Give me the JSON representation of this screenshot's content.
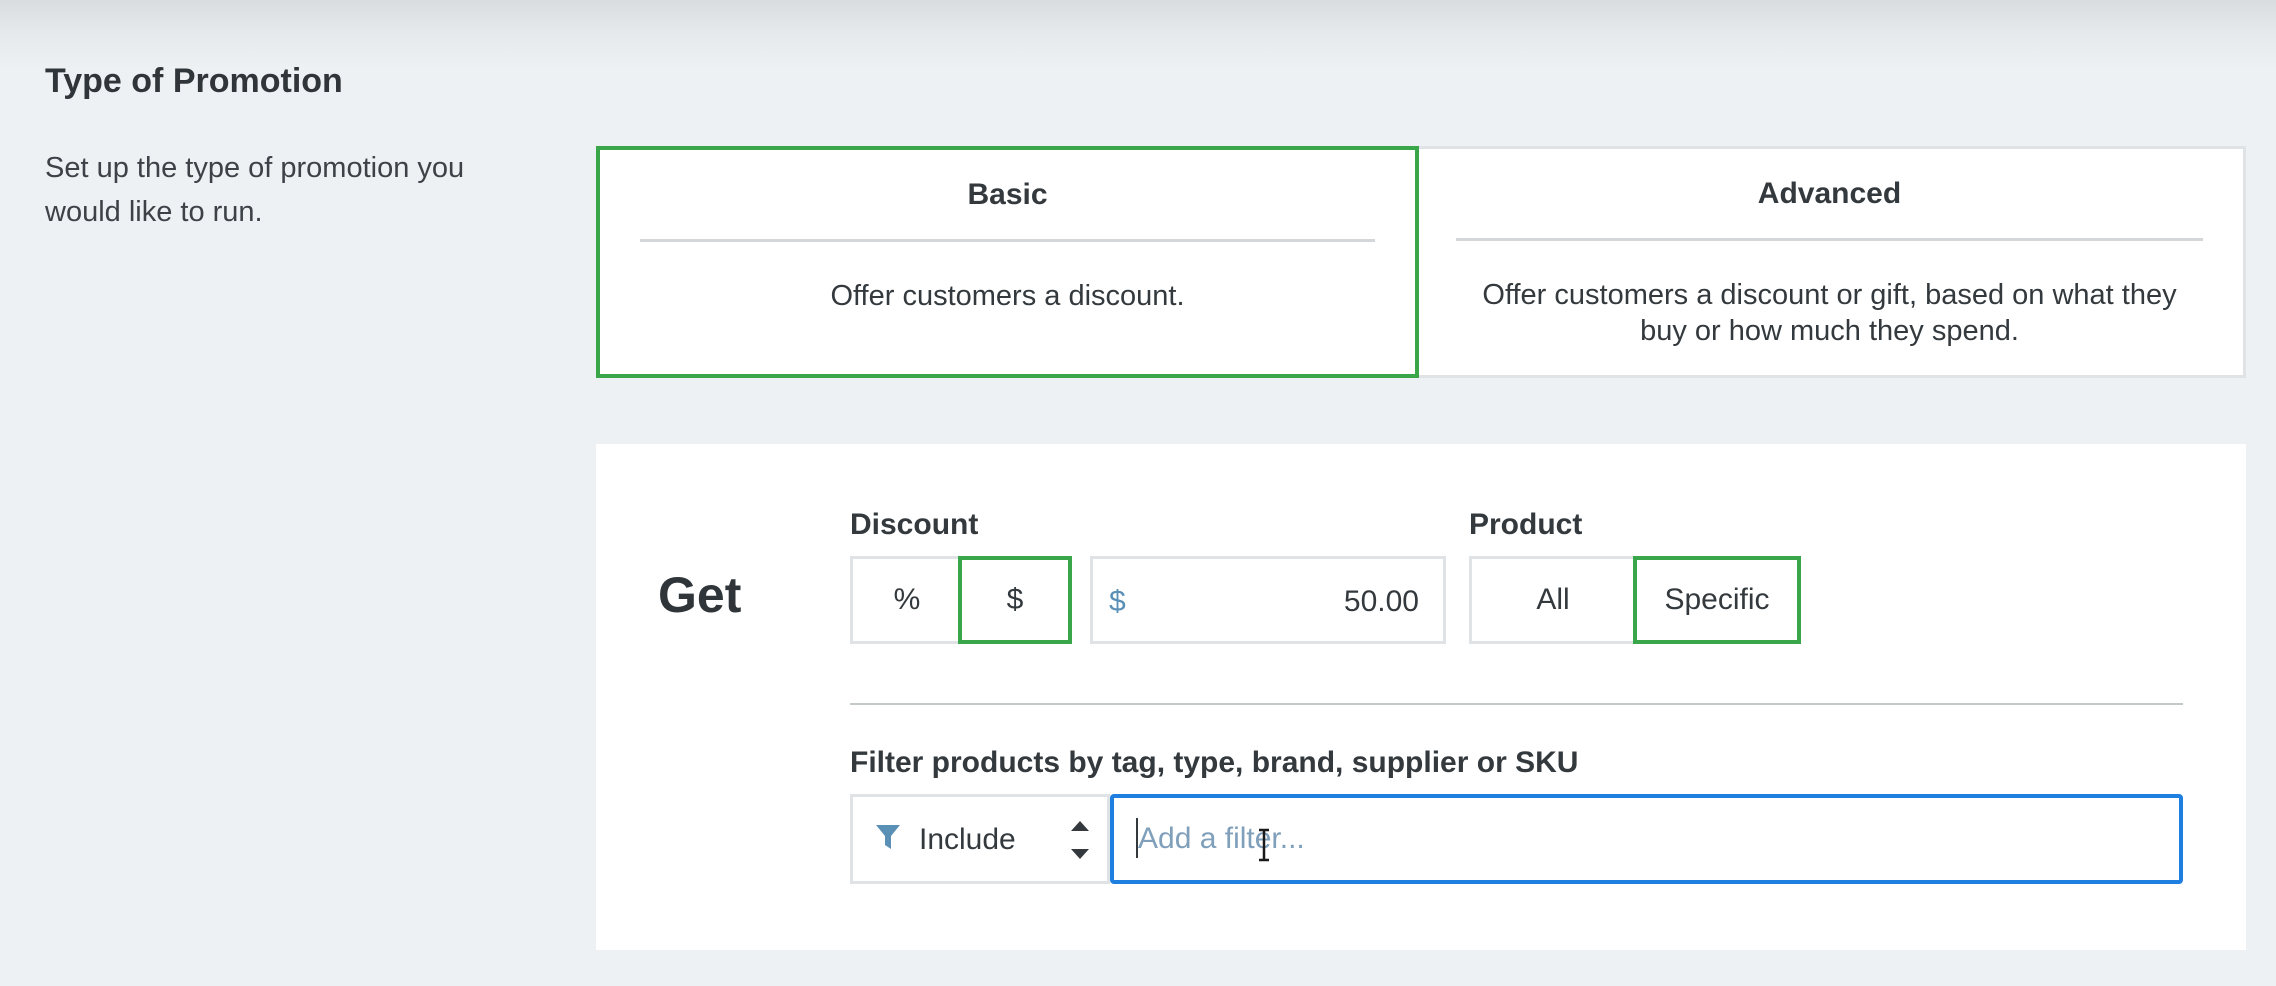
{
  "promotion_type": {
    "heading": "Type of Promotion",
    "description": "Set up the type of promotion you would like to run.",
    "options": [
      {
        "title": "Basic",
        "description": "Offer customers a discount.",
        "selected": true
      },
      {
        "title": "Advanced",
        "description": "Offer customers a discount or gift, based on what they buy or how much they spend.",
        "selected": false
      }
    ]
  },
  "get_panel": {
    "heading": "Get",
    "discount": {
      "label": "Discount",
      "modes": [
        "%",
        "$"
      ],
      "selected_mode": "$",
      "currency_prefix": "$",
      "value": "50.00"
    },
    "product": {
      "label": "Product",
      "modes": [
        "All",
        "Specific"
      ],
      "selected_mode": "Specific"
    },
    "filter": {
      "label": "Filter products by tag, type, brand, supplier or SKU",
      "mode": "Include",
      "placeholder": "Add a filter..."
    }
  },
  "icons": {
    "filter": "funnel-icon",
    "select_arrows": "up-down-arrows-icon",
    "cursor": "text-cursor-icon"
  },
  "colors": {
    "selected_border": "#3aa64a",
    "focus_border": "#1e7fe0",
    "background": "#eef1f3",
    "icon_blue": "#5a8fb6"
  }
}
